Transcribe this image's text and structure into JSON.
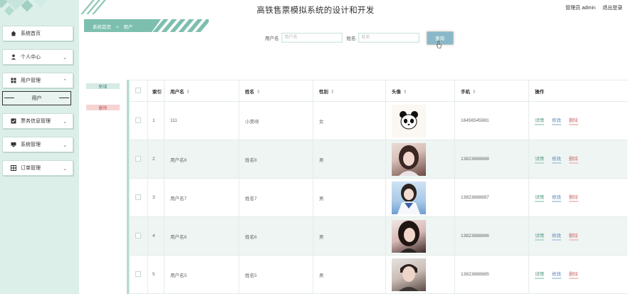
{
  "header": {
    "title": "高铁售票模拟系统的设计和开发",
    "user_role_label": "管理员 admin",
    "logout_label": "退出登录"
  },
  "breadcrumb": {
    "home": "系统首页",
    "separator": ">",
    "current": "用户"
  },
  "sidebar": {
    "items": [
      {
        "label": "系统首页",
        "icon": "home-icon",
        "has_chevron": false
      },
      {
        "label": "个人中心",
        "icon": "user-icon",
        "has_chevron": true,
        "chevron": "⌄"
      },
      {
        "label": "用户管理",
        "icon": "grid-icon",
        "has_chevron": true,
        "chevron": "⌃"
      },
      {
        "label": "票务信息管理",
        "icon": "check-square-icon",
        "has_chevron": true,
        "chevron": "⌄"
      },
      {
        "label": "系统管理",
        "icon": "monitor-icon",
        "has_chevron": true,
        "chevron": "⌄"
      },
      {
        "label": "订单管理",
        "icon": "table-icon",
        "has_chevron": true,
        "chevron": "⌄"
      }
    ],
    "submenu_active": "用户"
  },
  "search": {
    "username_label": "用户名",
    "username_placeholder": "用户名",
    "name_label": "姓名",
    "name_placeholder": "姓名",
    "button_label": "查询"
  },
  "actions": {
    "add_label": "新增",
    "delete_label": "删除"
  },
  "table": {
    "headers": {
      "index": "索引",
      "username": "用户名",
      "name": "姓名",
      "gender": "性别",
      "avatar": "头像",
      "phone": "手机",
      "operation": "操作"
    },
    "sort_glyph": "⇕",
    "op_labels": {
      "detail": "详情",
      "edit": "修改",
      "delete": "删除"
    },
    "rows": [
      {
        "index": "1",
        "username": "111",
        "name": "小昊呀",
        "gender": "女",
        "phone": "16456545981",
        "avatar_type": "panda"
      },
      {
        "index": "2",
        "username": "用户名8",
        "name": "姓名8",
        "gender": "男",
        "phone": "13823888888",
        "avatar_type": "photo"
      },
      {
        "index": "3",
        "username": "用户名7",
        "name": "姓名7",
        "gender": "男",
        "phone": "13823888887",
        "avatar_type": "photo"
      },
      {
        "index": "4",
        "username": "用户名6",
        "name": "姓名6",
        "gender": "男",
        "phone": "13823888886",
        "avatar_type": "photo"
      },
      {
        "index": "5",
        "username": "用户名5",
        "name": "姓名5",
        "gender": "男",
        "phone": "13823888885",
        "avatar_type": "photo"
      }
    ]
  },
  "colors": {
    "sidebar_bg": "#dcefe9",
    "accent": "#7dbfae",
    "search_button": "#8ab8c9",
    "row_alt": "#eef5f3"
  }
}
